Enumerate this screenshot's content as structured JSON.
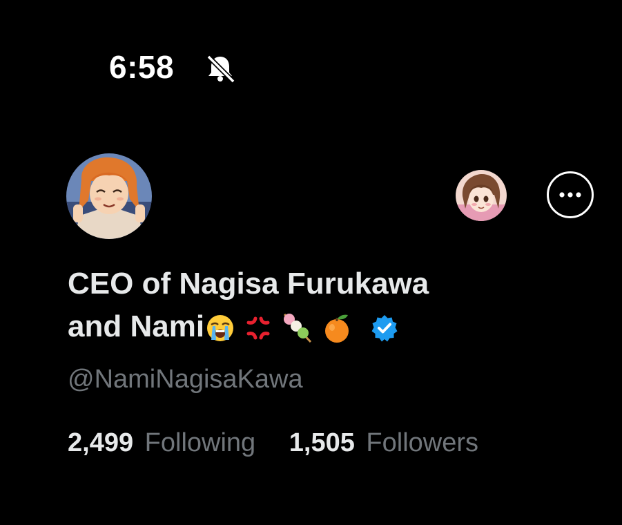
{
  "status_bar": {
    "time": "6:58",
    "icon": "bell-slash-icon"
  },
  "profile": {
    "avatar_icon": "profile-avatar",
    "secondary_avatar_icon": "account-switcher-avatar",
    "more_icon": "more-options-icon",
    "name_line1": "CEO of Nagisa Furukawa",
    "name_line2": "and Nami",
    "name_emojis": [
      "loudly-crying-face-icon",
      "anger-symbol-icon",
      "dango-icon",
      "tangerine-icon"
    ],
    "verified_icon": "verified-badge-icon",
    "handle": "@NamiNagisaKawa",
    "following_count": "2,499",
    "following_label": "Following",
    "followers_count": "1,505",
    "followers_label": "Followers"
  },
  "colors": {
    "background": "#000000",
    "primary_text": "#e7e9ea",
    "secondary_text": "#71767b",
    "verified": "#1d9bf0"
  }
}
